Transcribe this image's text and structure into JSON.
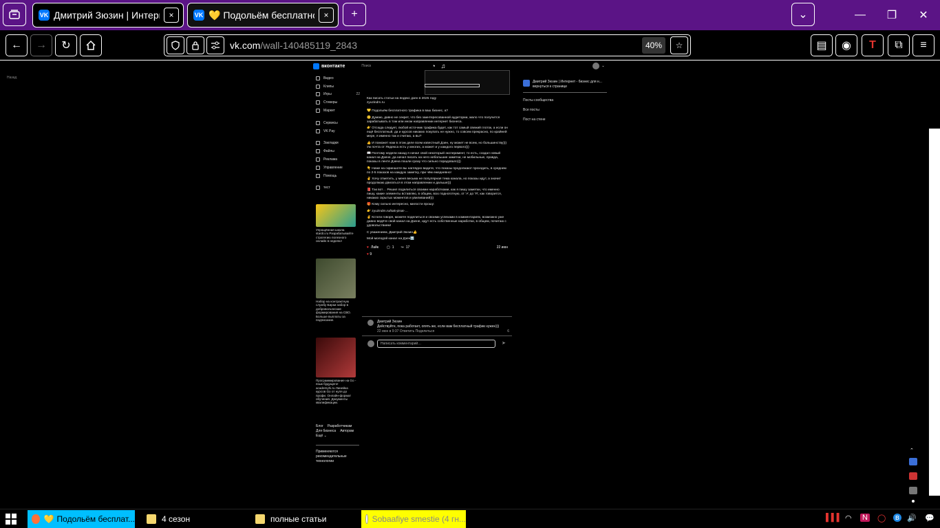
{
  "browser": {
    "tabs": [
      {
        "title": "Дмитрий Зюзин | Интернет -",
        "close": "×"
      },
      {
        "title": "💛 Подольём бесплатного тр",
        "close": "×"
      }
    ],
    "new_tab": "+",
    "tab_list": "⌄",
    "window_controls": {
      "minimize": "—",
      "maximize": "❐",
      "close": "✕"
    },
    "url_host": "vk.com",
    "url_path": "/wall-140485119_2843",
    "zoom": "40%",
    "tab_strip_color": "#5b1486"
  },
  "vk": {
    "logo": "вконтакте",
    "search_placeholder": "Поиск",
    "back_link": "Назад",
    "menu": [
      {
        "label": "Видео"
      },
      {
        "label": "Клипы"
      },
      {
        "label": "Игры",
        "badge": "22"
      },
      {
        "label": "Стикеры"
      },
      {
        "label": "Маркет"
      },
      {
        "sep": true
      },
      {
        "label": "Сервисы"
      },
      {
        "label": "VK Pay"
      },
      {
        "sep": true
      },
      {
        "label": "Закладки"
      },
      {
        "label": "Файлы"
      },
      {
        "label": "Реклама"
      },
      {
        "label": "Управление"
      },
      {
        "label": "Помощь"
      },
      {
        "sep": true
      },
      {
        "label": "тест"
      }
    ],
    "ads": [
      {
        "text": "Упрощённая школа stardo.ru Разрабатывайте стратегию полезного онлайн в неделю!"
      },
      {
        "text": "Набор на контрактную службу Бирки набор в добровольческие формирования на СВО. Больше выплаты за подписание."
      },
      {
        "text": "Программирование на Go - язык будущего! academyhi.ru Линейка курсов Go от нуля до профи. Онлайн-формат обучения. Документы квалификации."
      }
    ],
    "footer_links": [
      "Блог",
      "Разработчикам",
      "Для бизнеса",
      "Авторам",
      "Ещё ⌄"
    ],
    "footer_note": "Применяются рекомендательные технологии",
    "post": {
      "title": "Как писать статьи на яндекс дзен в 2025 году",
      "link": "zyuzindm.ru",
      "paragraphs": [
        "💛 Подольём бесплатного трафика в ваш бизнес, а?",
        "😊 Думаю, давно не секрет, что без заинтересованной аудитории, мало что получится зарабатывать в том или ином направлении интернет бизнеса.",
        "👉 Отсюда следует, любой источник трафика будет, как тот самый свежий глоток, а если он ещё бесплатный, да и курсов никаких покупать не нужно, то совсем прекрасно, по крайней мере, я именно так и считаю, а вы?",
        "👍 И поможет нам в этом деле всем известный Дзен, ну может не всем, но большинству))) Уж почта от Яндекса есть у многих, а может и у каждого первого)))",
        "📖 Поэтому недели назад я начал свой некоторый эксперимент, то есть, создал новый канал на Дзене, да начал писать на него небольшие заметки, не мобильные, правда, показы в ленте Дзена пошли сразу что сильно порадовало)))",
        "👇 Ниже на скриншоте вы наглядно видите, что показы продолжают проходить, в среднем по 2-5 показов на каждую заметку, при чём ежедневно!",
        "✌ Хочу отметить, у меня весьма не популярная тема канала, но показы идут, а значит продолжаю двигаться в этом направлении и дальше)))",
        "📕 Так вот… Решил поделиться своими наработками, как я пишу заметки, что именно пишу, какие элементы вставляю, в общем, всю подноготную, от 'А' до 'Я', как говорится, никаких скрытых моментов и увиливаний)))",
        "🎁 Кому сильно интересно, милости прошу:",
        "👉 zyuzindm.ru/kak-pisat-…",
        "✌ Кстати говоря, можете поделиться и своими успехами в комментариях, возможно уже давно ведёте свой канал на Дзене, идут есть собственные наработки, в общем, почитаю с удовольствием!",
        "С уважением, Дмитрий Зюзин👍",
        "Мой молодой канал на Дзен🔜"
      ],
      "like": "Лайк",
      "comments": "1",
      "shares": "17",
      "date": "22 июн",
      "reactions": "9"
    },
    "comment": {
      "author": "Дмитрий Зюзин",
      "text": "Действуйте, пока работает, опять же, если вам бесплатный трафик нужен)))",
      "meta": "22 июн в 9:37   Ответить   Поделиться",
      "likes": "6"
    },
    "comment_placeholder": "Написать комментарий…",
    "right": {
      "group": "Дмитрий Зюзин | Интернет - бизнес для н... вернуться к странице",
      "links": [
        "Посты сообщества",
        "Все посты",
        "Пост на стене"
      ]
    }
  },
  "taskbar": {
    "items": [
      {
        "label": "Подольём бесплат...",
        "bg": "#00bfff"
      },
      {
        "label": "4 сезон"
      },
      {
        "label": "полные статьи"
      },
      {
        "label": "Sobaafiye smestie (4 гн...",
        "bg": "#ffff00"
      }
    ],
    "tray": [
      "▌▌▌",
      "◠",
      "N",
      "◯",
      "ʙ",
      "🔊",
      "💬"
    ]
  }
}
